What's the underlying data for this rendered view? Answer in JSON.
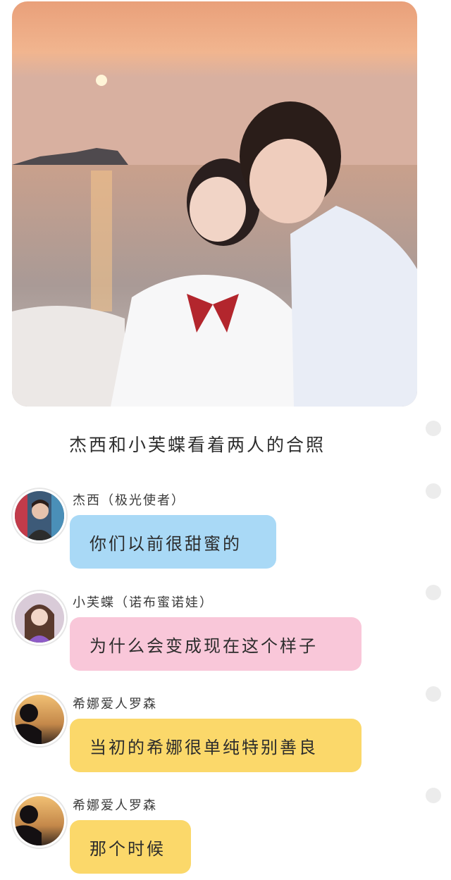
{
  "scene": {
    "caption": "杰西和小芙蝶看着两人的合照"
  },
  "messages": [
    {
      "sender": "杰西（极光使者）",
      "text": "你们以前很甜蜜的",
      "bubble_color": "#a9d9f6",
      "avatar": "avatar-boy-photo"
    },
    {
      "sender": "小芙蝶（诺布蜜诺娃）",
      "text": "为什么会变成现在这个样子",
      "bubble_color": "#f9c7d9",
      "avatar": "avatar-girl-photo"
    },
    {
      "sender": "希娜爱人罗森",
      "text": "当初的希娜很单纯特别善良",
      "bubble_color": "#fbd86a",
      "avatar": "avatar-sunset-silhouette"
    },
    {
      "sender": "希娜爱人罗森",
      "text": "那个时候",
      "bubble_color": "#fbd86a",
      "avatar": "avatar-sunset-silhouette"
    }
  ]
}
